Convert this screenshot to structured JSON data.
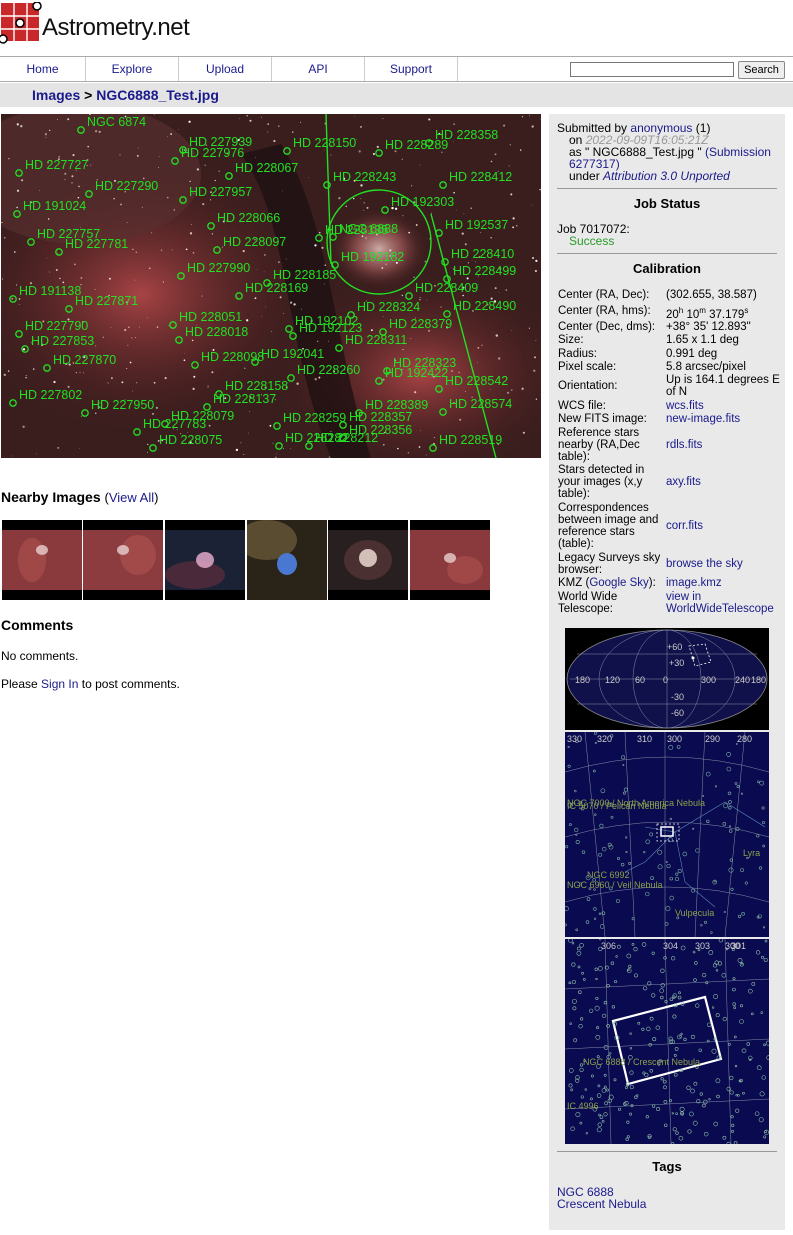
{
  "header": {
    "logo_text": "Astrometry.net"
  },
  "nav": {
    "items": [
      "Home",
      "Explore",
      "Upload",
      "API",
      "Support"
    ],
    "search_placeholder": "",
    "search_button": "Search"
  },
  "breadcrumb": {
    "root": "Images",
    "separator": ">",
    "current": "NGC6888_Test.jpg"
  },
  "annotations": {
    "labels": [
      "NGC 6874",
      "HD 227939",
      "HD 227976",
      "HD 228150",
      "HD 228358",
      "HD 228289",
      "HD 227727",
      "HD 228067",
      "HD 228243",
      "HD 228412",
      "HD 227290",
      "HD 227957",
      "HD 192303",
      "HD 228066",
      "HD 192537",
      "HD 227757",
      "HD 227781",
      "HD 228097",
      "HD 228410",
      "HD 192182",
      "HD 227990",
      "HD 228185",
      "HD 228499",
      "HD 191138",
      "HD 227871",
      "HD 228169",
      "HD 228324",
      "HD 228490",
      "HD 228051",
      "HD 192102",
      "HD 228379",
      "HD 227790",
      "HD 228018",
      "HD 192123",
      "HD 228311",
      "HD 227853",
      "HD 228098",
      "HD 192041",
      "HD 228323",
      "HD 227870",
      "HD 228260",
      "HD 192422",
      "HD 228542",
      "HD 227802",
      "HD 228158",
      "HD 228137",
      "HD 228389",
      "HD 228574",
      "HD 227950",
      "HD 228079",
      "HD 228259",
      "HD 228357",
      "HD 227783",
      "HD 228356",
      "HD 228212",
      "HD 228075",
      "HD 228282",
      "HD 228519",
      "HD 191024",
      "HD 228135",
      "HD 228409",
      "NGC 6888"
    ],
    "label_color": "#22e022"
  },
  "nearby": {
    "title": "Nearby Images",
    "view_all": "View All"
  },
  "comments": {
    "title": "Comments",
    "none_text": "No comments.",
    "please": "Please",
    "sign_in": "Sign In",
    "to_post": "to post comments."
  },
  "submission": {
    "submitted_by": "Submitted by",
    "user": "anonymous",
    "count": "(1)",
    "on": "on",
    "date": "2022-09-09T16:05:21Z",
    "as": "as",
    "filename_q": "\" NGC6888_Test.jpg \"",
    "submission_link": "(Submission 6277317)",
    "under": "under",
    "license": "Attribution 3.0 Unported"
  },
  "job": {
    "title": "Job Status",
    "label": "Job 7017072:",
    "status": "Success",
    "status_color": "#2a9a2a"
  },
  "calibration": {
    "title": "Calibration",
    "rows": [
      {
        "k": "Center (RA, Dec):",
        "v": "(302.655, 38.587)"
      },
      {
        "k": "Center (RA, hms):",
        "v": "20h 10m 37.179s"
      },
      {
        "k": "Center (Dec, dms):",
        "v": "+38° 35' 12.893\""
      },
      {
        "k": "Size:",
        "v": "1.65 x 1.1 deg"
      },
      {
        "k": "Radius:",
        "v": "0.991 deg"
      },
      {
        "k": "Pixel scale:",
        "v": "5.8 arcsec/pixel"
      },
      {
        "k": "Orientation:",
        "v": "Up is 164.1 degrees E of N"
      },
      {
        "k": "WCS file:",
        "v": "wcs.fits"
      },
      {
        "k": "New FITS image:",
        "v": "new-image.fits"
      },
      {
        "k": "Reference stars nearby (RA,Dec table):",
        "v": "rdls.fits"
      },
      {
        "k": "Stars detected in your images (x,y table):",
        "v": "axy.fits"
      },
      {
        "k": "Correspondences between image and reference stars (table):",
        "v": "corr.fits"
      },
      {
        "k": "Legacy Surveys sky browser:",
        "v": "browse the sky"
      },
      {
        "k": "KMZ (Google Sky):",
        "v": "image.kmz"
      },
      {
        "k": "World Wide Telescope:",
        "v": "view in WorldWideTelescope"
      }
    ],
    "ra_hms": {
      "h": "20",
      "hsup": "h",
      "m": "10",
      "msup": "m",
      "s": "37.179",
      "ssup": "s"
    },
    "kmz_key": "KMZ (",
    "kmz_link": "Google Sky",
    "kmz_end": "):"
  },
  "sky_maps": {
    "allsky_ra_ticks": [
      "180",
      "120",
      "60",
      "0",
      "300",
      "240",
      "180"
    ],
    "allsky_dec_ticks": [
      "+60",
      "+30",
      "-30",
      "-60"
    ],
    "zoom1_ra_ticks": [
      "330",
      "320",
      "310",
      "300",
      "290",
      "280"
    ],
    "zoom1_labels": [
      "NGC 7000 / North America Nebula",
      "IC 5070 / Pelican Nebula",
      "NGC 6992",
      "NGC 6960 / Veil Nebula",
      "Vulpecula",
      "Lyra"
    ],
    "zoom2_ra_ticks": [
      "306",
      "304",
      "303",
      "300",
      "301"
    ],
    "zoom2_labels": [
      "NGC 6888 / Crescent Nebula",
      "IC 4996"
    ],
    "grid_color": "#8890a8",
    "label_color": "#8ca04a"
  },
  "tags": {
    "title": "Tags",
    "items": [
      "NGC 6888",
      "Crescent Nebula"
    ]
  }
}
